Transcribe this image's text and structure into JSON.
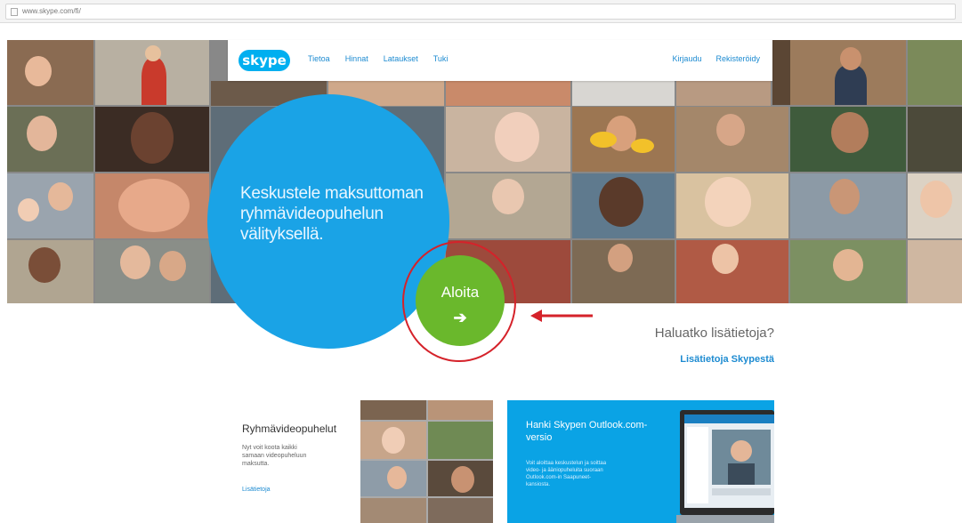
{
  "browser": {
    "url": "www.skype.com/fi/"
  },
  "nav": {
    "logo": "skype",
    "links": [
      "Tietoa",
      "Hinnat",
      "Lataukset",
      "Tuki"
    ],
    "right": [
      "Kirjaudu",
      "Rekisteröidy"
    ]
  },
  "hero": {
    "headline": "Keskustele maksuttoman ryhmävideopuhelun välityksellä.",
    "cta": "Aloita",
    "cta_arrow": "➔",
    "more_question": "Haluatko lisätietoja?",
    "more_link": "Lisätietoja Skypestä"
  },
  "card_group": {
    "title": "Ryhmävideopuhelut",
    "desc": "Nyt voit koota kaikki samaan videopuheluun maksutta.",
    "link": "Lisätietoja"
  },
  "card_outlook": {
    "title": "Hanki Skypen Outlook.com-versio",
    "desc": "Voit aloittaa keskustelun ja soittaa video- ja ääniopuheluita suoraan Outlook.com-in Saapuneet-kansiosta."
  },
  "colors": {
    "skype_blue": "#00aff0",
    "cta_green": "#6ab82c",
    "annotation_red": "#d5222a"
  }
}
